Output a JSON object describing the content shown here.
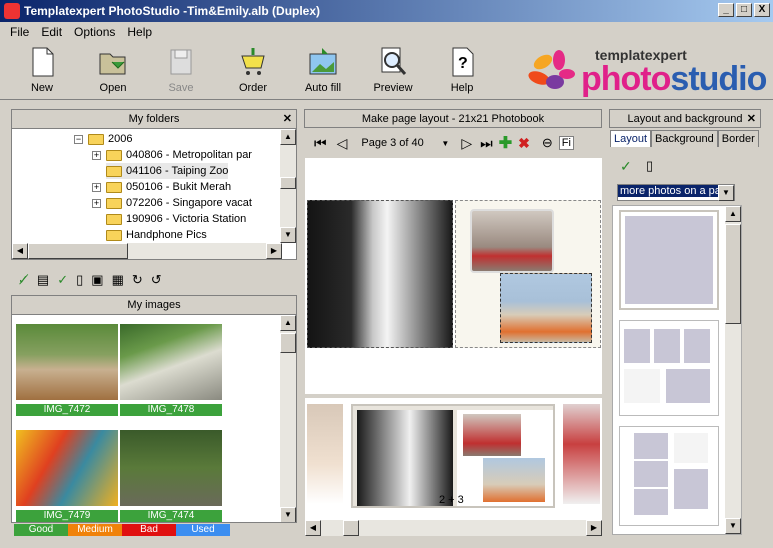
{
  "window": {
    "title": "Templatexpert PhotoStudio -Tim&Emily.alb (Duplex)",
    "btn_min": "_",
    "btn_max": "□",
    "btn_close": "X"
  },
  "menu": [
    "File",
    "Edit",
    "Options",
    "Help"
  ],
  "toolbar": {
    "new": "New",
    "open": "Open",
    "save": "Save",
    "order": "Order",
    "autofill": "Auto fill",
    "preview": "Preview",
    "help": "Help"
  },
  "logo": {
    "small": "templatexpert",
    "big_a": "photo",
    "big_b": "studio"
  },
  "folders": {
    "title": "My folders",
    "close": "✕",
    "items": [
      {
        "label": "2006",
        "indent": 1,
        "expand": "−"
      },
      {
        "label": "040806 - Metropolitan par",
        "indent": 2,
        "expand": "+"
      },
      {
        "label": "041106 - Taiping Zoo",
        "indent": 2,
        "expand": ""
      },
      {
        "label": "050106 - Bukit Merah",
        "indent": 2,
        "expand": "+"
      },
      {
        "label": "072206 - Singapore vacat",
        "indent": 2,
        "expand": "+"
      },
      {
        "label": "190906 - Victoria Station",
        "indent": 2,
        "expand": ""
      },
      {
        "label": "Handphone Pics",
        "indent": 2,
        "expand": ""
      }
    ]
  },
  "images": {
    "title": "My images",
    "items": [
      "IMG_7472",
      "IMG_7478",
      "IMG_7479",
      "IMG_7474"
    ]
  },
  "legend": {
    "good": "Good",
    "medium": "Medium",
    "bad": "Bad",
    "used": "Used",
    "colors": {
      "good": "#3ca23c",
      "medium": "#f0820a",
      "bad": "#e01010",
      "used": "#3c8ef0"
    }
  },
  "layout": {
    "title": "Make page layout - 21x21 Photobook",
    "page_select": "Page 3 of 40",
    "fit": "Fi",
    "spread_label": "2 + 3"
  },
  "right": {
    "title": "Layout and background",
    "close": "✕",
    "tabs": [
      "Layout",
      "Background",
      "Border"
    ],
    "dropdown": "more photos on a pa"
  }
}
